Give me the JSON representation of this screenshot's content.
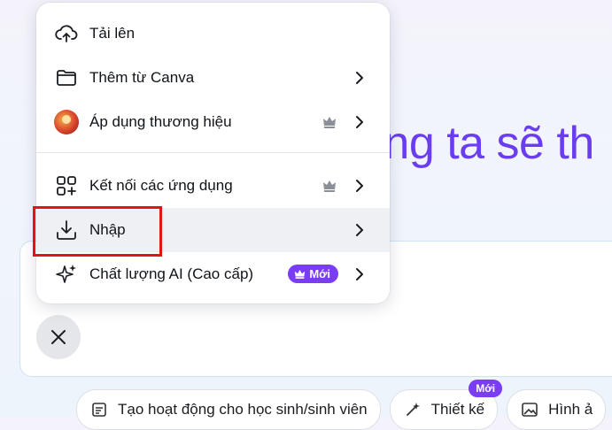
{
  "headline": "úng ta sẽ th",
  "menu": {
    "items": [
      {
        "label": "Tải lên",
        "icon": "cloud-upload-icon"
      },
      {
        "label": "Thêm từ Canva",
        "icon": "folder-icon"
      },
      {
        "label": "Áp dụng thương hiệu",
        "icon": "brand-avatar"
      },
      {
        "label": "Kết nối các ứng dụng",
        "icon": "apps-grid-icon"
      },
      {
        "label": "Nhập",
        "icon": "import-download-icon"
      },
      {
        "label": "Chất lượng AI (Cao cấp)",
        "icon": "sparkles-icon",
        "badge": "Mới"
      }
    ]
  },
  "chips": [
    {
      "label": "Tạo hoạt động cho học sinh/sinh viên",
      "icon": "activity-icon"
    },
    {
      "label": "Thiết kế",
      "icon": "magic-icon",
      "badge": "Mới"
    },
    {
      "label": "Hình ả",
      "icon": "image-icon"
    }
  ],
  "colors": {
    "accent": "#7a3cf5",
    "headline": "#6b3df0",
    "highlight": "#e01616"
  }
}
